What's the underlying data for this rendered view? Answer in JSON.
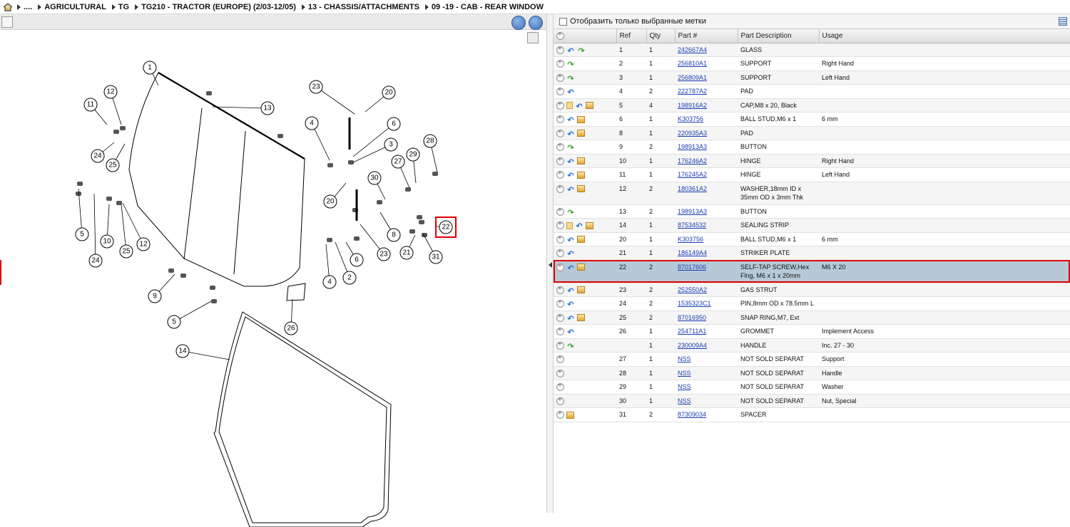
{
  "breadcrumb": [
    {
      "label": "...."
    },
    {
      "label": "AGRICULTURAL"
    },
    {
      "label": "TG"
    },
    {
      "label": "TG210 - TRACTOR (EUROPE) (2/03-12/05)"
    },
    {
      "label": "13 - CHASSIS/ATTACHMENTS"
    },
    {
      "label": "09 -19 - CAB - REAR WINDOW"
    }
  ],
  "filter": {
    "label": "Отобразить только выбранные метки"
  },
  "table": {
    "headers": {
      "ref": "Ref",
      "qty": "Qty",
      "part": "Part #",
      "desc": "Part Description",
      "usage": "Usage"
    },
    "rows": [
      {
        "ref": "1",
        "qty": "1",
        "part": "242667A4",
        "desc": "GLASS",
        "usage": "",
        "icons": [
          "blue",
          "green"
        ]
      },
      {
        "ref": "2",
        "qty": "1",
        "part": "256810A1",
        "desc": "SUPPORT",
        "usage": "Right Hand",
        "icons": [
          "green"
        ]
      },
      {
        "ref": "3",
        "qty": "1",
        "part": "256809A1",
        "desc": "SUPPORT",
        "usage": "Left Hand",
        "icons": [
          "green"
        ]
      },
      {
        "ref": "4",
        "qty": "2",
        "part": "222787A2",
        "desc": "PAD",
        "usage": "",
        "icons": [
          "blue"
        ]
      },
      {
        "ref": "5",
        "qty": "4",
        "part": "198916A2",
        "desc": "CAP,M8 x 20, Black",
        "usage": "",
        "icons": [
          "note",
          "blue",
          "box"
        ]
      },
      {
        "ref": "6",
        "qty": "1",
        "part": "K303756",
        "desc": "BALL STUD,M6 x 1",
        "usage": "6 mm",
        "icons": [
          "blue",
          "box"
        ]
      },
      {
        "ref": "8",
        "qty": "1",
        "part": "220935A3",
        "desc": "PAD",
        "usage": "",
        "icons": [
          "blue",
          "box"
        ]
      },
      {
        "ref": "9",
        "qty": "2",
        "part": "198913A3",
        "desc": "BUTTON",
        "usage": "",
        "icons": [
          "green"
        ]
      },
      {
        "ref": "10",
        "qty": "1",
        "part": "176246A2",
        "desc": "HINGE",
        "usage": "Right Hand",
        "icons": [
          "blue",
          "box"
        ]
      },
      {
        "ref": "11",
        "qty": "1",
        "part": "176245A2",
        "desc": "HINGE",
        "usage": "Left Hand",
        "icons": [
          "blue",
          "box"
        ]
      },
      {
        "ref": "12",
        "qty": "2",
        "part": "180361A2",
        "desc": "WASHER,18mm ID x 35mm OD x 3mm Thk",
        "usage": "",
        "icons": [
          "blue",
          "box"
        ],
        "tall": true
      },
      {
        "ref": "13",
        "qty": "2",
        "part": "198913A3",
        "desc": "BUTTON",
        "usage": "",
        "icons": [
          "green"
        ]
      },
      {
        "ref": "14",
        "qty": "1",
        "part": "87534532",
        "desc": "SEALING STRIP",
        "usage": "",
        "icons": [
          "note",
          "blue",
          "box"
        ]
      },
      {
        "ref": "20",
        "qty": "1",
        "part": "K303756",
        "desc": "BALL STUD,M6 x 1",
        "usage": "6 mm",
        "icons": [
          "blue",
          "box"
        ]
      },
      {
        "ref": "21",
        "qty": "1",
        "part": "186149A4",
        "desc": "STRIKER PLATE",
        "usage": "",
        "icons": [
          "blue"
        ]
      },
      {
        "ref": "22",
        "qty": "2",
        "part": "87017606",
        "desc": "SELF-TAP SCREW,Hex Flng, M6 x 1 x 20mm",
        "usage": "M6 X 20",
        "icons": [
          "blue",
          "box"
        ],
        "tall": true,
        "selected": true
      },
      {
        "ref": "23",
        "qty": "2",
        "part": "252550A2",
        "desc": "GAS STRUT",
        "usage": "",
        "icons": [
          "blue",
          "box"
        ]
      },
      {
        "ref": "24",
        "qty": "2",
        "part": "1535323C1",
        "desc": "PIN,8mm OD x 78.5mm L",
        "usage": "",
        "icons": [
          "blue"
        ]
      },
      {
        "ref": "25",
        "qty": "2",
        "part": "87016950",
        "desc": "SNAP RING,M7, Ext",
        "usage": "",
        "icons": [
          "blue",
          "box"
        ]
      },
      {
        "ref": "26",
        "qty": "1",
        "part": "254711A1",
        "desc": "GROMMET",
        "usage": "Implement Access",
        "icons": [
          "blue"
        ]
      },
      {
        "ref": "",
        "qty": "1",
        "part": "230009A4",
        "desc": "HANDLE",
        "usage": "Inc. 27 - 30",
        "icons": [
          "green"
        ]
      },
      {
        "ref": "27",
        "qty": "1",
        "part": "NSS",
        "desc": "NOT SOLD SEPARAT",
        "usage": "Support",
        "icons": []
      },
      {
        "ref": "28",
        "qty": "1",
        "part": "NSS",
        "desc": "NOT SOLD SEPARAT",
        "usage": "Handle",
        "icons": []
      },
      {
        "ref": "29",
        "qty": "1",
        "part": "NSS",
        "desc": "NOT SOLD SEPARAT",
        "usage": "Washer",
        "icons": []
      },
      {
        "ref": "30",
        "qty": "1",
        "part": "NSS",
        "desc": "NOT SOLD SEPARAT",
        "usage": "Nut, Special",
        "icons": []
      },
      {
        "ref": "31",
        "qty": "2",
        "part": "87309034",
        "desc": "SPACER",
        "usage": "",
        "icons": [
          "box"
        ]
      }
    ]
  },
  "diagram": {
    "callouts": [
      "1",
      "12",
      "11",
      "13",
      "23",
      "20",
      "24",
      "25",
      "4",
      "6",
      "3",
      "28",
      "29",
      "27",
      "30",
      "22",
      "20",
      "8",
      "21",
      "31",
      "23",
      "6",
      "2",
      "4",
      "5",
      "10",
      "24",
      "25",
      "12",
      "9",
      "5",
      "26",
      "14"
    ]
  }
}
